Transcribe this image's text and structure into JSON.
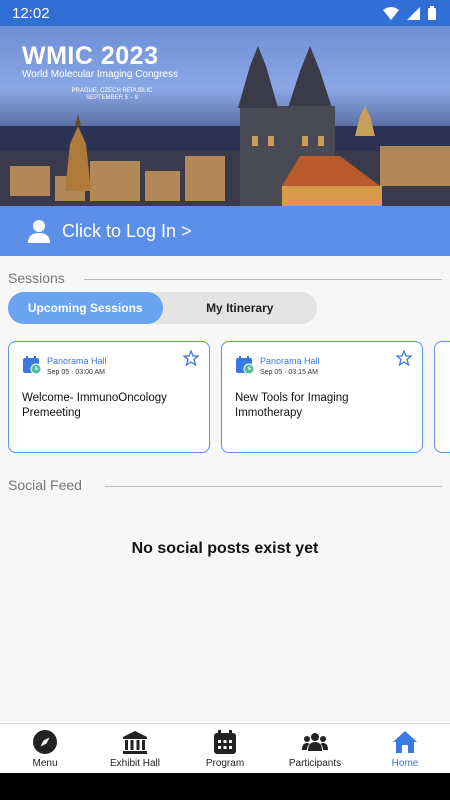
{
  "status_bar": {
    "time": "12:02"
  },
  "banner": {
    "title": "WMIC 2023",
    "subtitle": "World Molecular Imaging Congress",
    "location_line1": "PRAGUE, CZECH REPUBLIC",
    "location_line2": "SEPTEMBER 5 – 9"
  },
  "login": {
    "label": "Click to Log In >"
  },
  "sessions": {
    "heading": "Sessions",
    "tabs": [
      {
        "label": "Upcoming Sessions",
        "active": true
      },
      {
        "label": "My Itinerary",
        "active": false
      }
    ],
    "cards": [
      {
        "location": "Panorama Hall",
        "time": "Sep 05 · 03:00 AM",
        "title": "Welcome- ImmunoOncology Premeeting"
      },
      {
        "location": "Panorama Hall",
        "time": "Sep 05 · 03:15 AM",
        "title": "New Tools for Imaging Immotherapy"
      }
    ]
  },
  "social": {
    "heading": "Social Feed",
    "empty_message": "No social posts exist yet"
  },
  "bottom_nav": {
    "items": [
      {
        "label": "Menu",
        "icon": "compass-icon"
      },
      {
        "label": "Exhibit Hall",
        "icon": "building-icon"
      },
      {
        "label": "Program",
        "icon": "calendar-icon"
      },
      {
        "label": "Participants",
        "icon": "people-icon"
      },
      {
        "label": "Home",
        "icon": "home-icon",
        "active": true
      }
    ]
  },
  "colors": {
    "primary": "#2f6fd6",
    "accent": "#5b8fe8",
    "active_tab": "#6aa3f0"
  }
}
